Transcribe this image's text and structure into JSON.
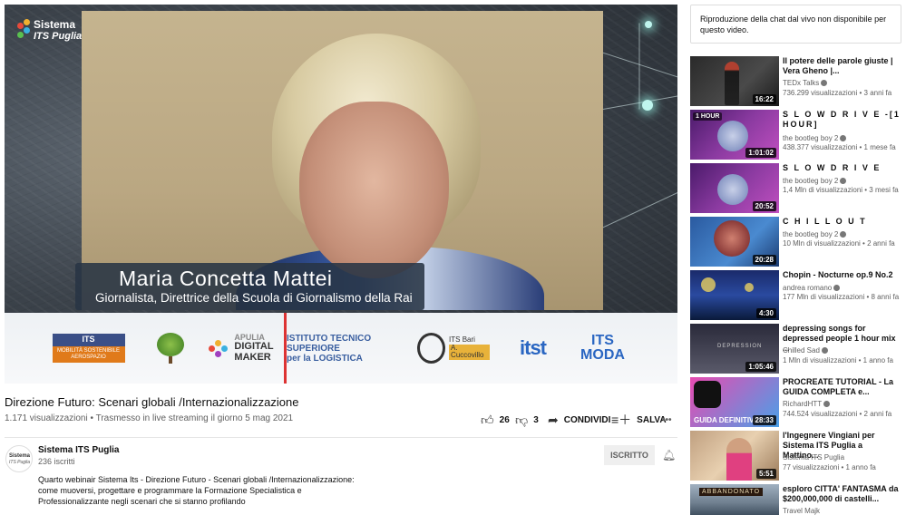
{
  "player": {
    "logo_line1": "Sistema",
    "logo_line2": "ITS Puglia",
    "lower_third_name": "Maria Concetta Mattei",
    "lower_third_role": "Giornalista, Direttrice della Scuola di Giornalismo della Rai",
    "sponsors": {
      "its_top": "ITS",
      "its_bottom": "MOBILITÀ SOSTENIBILE AEROSPAZIO",
      "apulia_1": "APULIA",
      "apulia_2": "DIGITAL",
      "apulia_3": "MAKER",
      "logistica_1": "ISTITUTO TECNICO SUPERIORE",
      "logistica_2": "per la LOGISTICA",
      "bari_1": "ITS Bari",
      "bari_2": "A. Cuccovillo",
      "itst": "itst",
      "moda_1": "ITS",
      "moda_2": "MODA"
    }
  },
  "video": {
    "title": "Direzione Futuro: Scenari globali /Internazionalizzazione",
    "meta": "1.171 visualizzazioni • Trasmesso in live streaming il giorno 5 mag 2021",
    "likes": "26",
    "dislikes": "3",
    "share_label": "CONDIVIDI",
    "save_label": "SALVA",
    "more_label": "•••"
  },
  "channel": {
    "name": "Sistema ITS Puglia",
    "subscribers": "236 iscritti",
    "avatar_1": "Sistema",
    "avatar_2": "ITS Puglia",
    "subscribe_label": "ISCRITTO",
    "description": "Quarto webinair Sistema Its - Direzione Futuro - Scenari globali /Internazionalizzazione: come muoversi, progettare e programmare la Formazione Specialistica e Professionalizzante negli scenari che si stanno profilando"
  },
  "chat": {
    "message": "Riproduzione della chat dal vivo non disponibile per questo video."
  },
  "recommendations": [
    {
      "title": "Il potere delle parole giuste | Vera Gheno |...",
      "channel": "TEDx Talks",
      "stats": "736.299 visualizzazioni • 3 anni fa",
      "duration": "16:22"
    },
    {
      "title": "S L O W   D R I V E -[1 HOUR]",
      "channel": "the bootleg boy 2",
      "stats": "438.377 visualizzazioni • 1 mese fa",
      "duration": "1:01:02",
      "badge": "1 HOUR"
    },
    {
      "title": "S L O W   D R I V E",
      "channel": "the bootleg boy 2",
      "stats": "1,4 Mln di visualizzazioni • 3 mesi fa",
      "duration": "20:52"
    },
    {
      "title": "C H I L L O U T",
      "channel": "the bootleg boy 2",
      "stats": "10 Mln di visualizzazioni • 2 anni fa",
      "duration": "20:28"
    },
    {
      "title": "Chopin - Nocturne op.9 No.2",
      "channel": "andrea romano",
      "stats": "177 Mln di visualizzazioni • 8 anni fa",
      "duration": "4:30"
    },
    {
      "title": "depressing songs for depressed people 1 hour mix ...",
      "channel": "Chilled Sad",
      "stats": "1 Mln di visualizzazioni • 1 anno fa",
      "duration": "1:05:46",
      "thumb_text": "DEPRESSION"
    },
    {
      "title": "PROCREATE TUTORIAL - La GUIDA COMPLETA e...",
      "channel": "RichardHTT",
      "stats": "744.524 visualizzazioni • 2 anni fa",
      "duration": "28:33",
      "thumb_text": "GUIDA DEFINITIVA"
    },
    {
      "title": "l'Ingegnere Vingiani per Sistema ITS Puglia a Mattino...",
      "channel": "Sistema ITS Puglia",
      "stats": "77 visualizzazioni • 1 anno fa",
      "duration": "5:51"
    },
    {
      "title": "esploro CITTA' FANTASMA da $200,000,000 di castelli...",
      "channel": "Travel Majk",
      "stats": "",
      "duration": "",
      "thumb_text": "ABBANDONATO"
    }
  ]
}
